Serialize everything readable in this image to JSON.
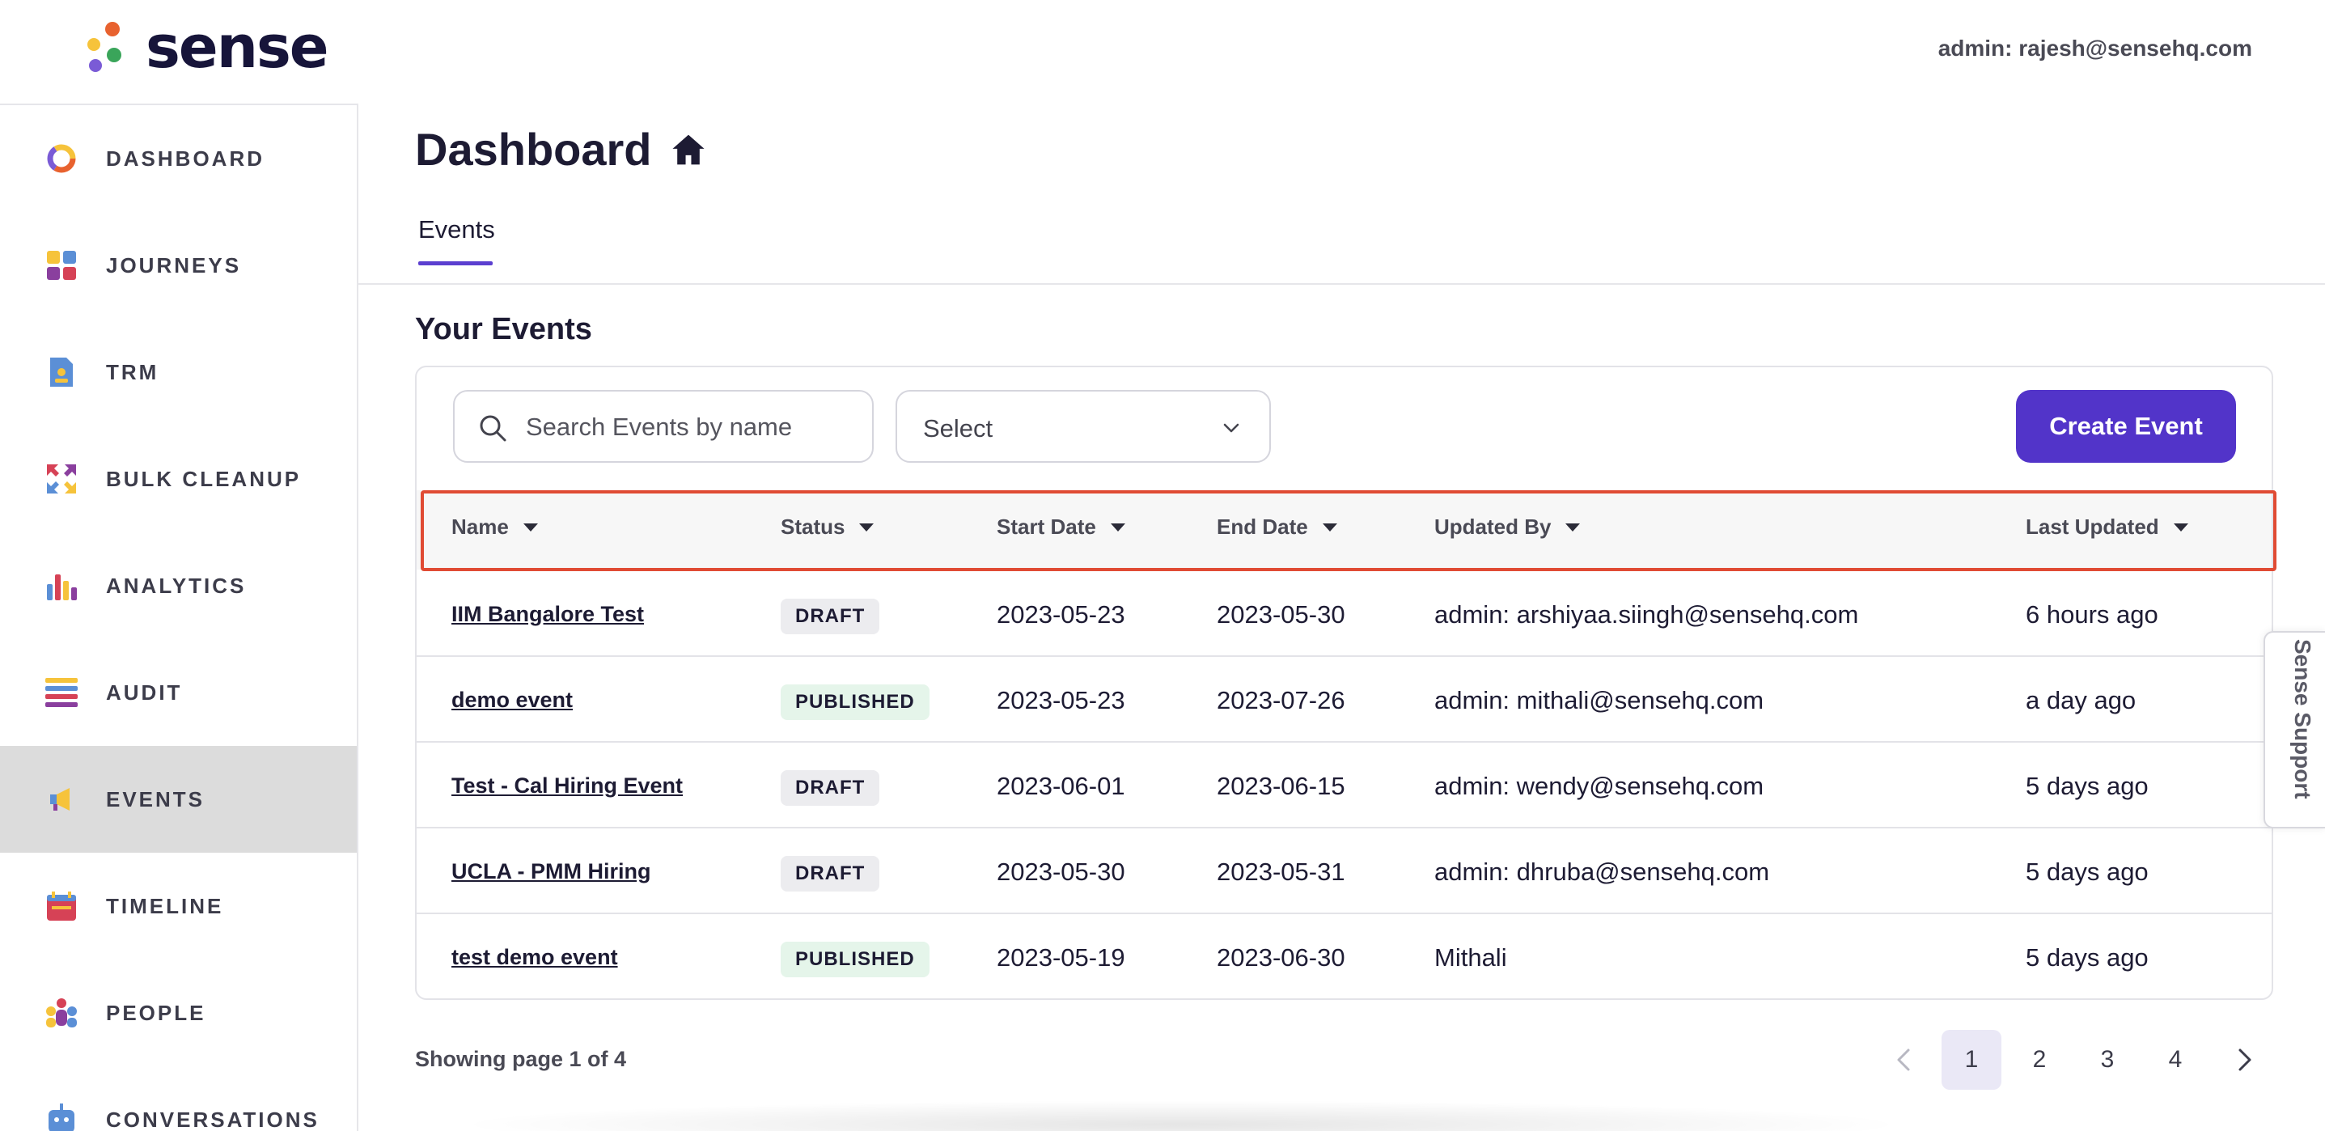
{
  "brand": {
    "name": "sense",
    "colors": {
      "accent": "#5234c9",
      "highlight_outline": "#e04b34",
      "dot_orange": "#e8622f",
      "dot_yellow": "#f6c33b",
      "dot_green": "#3aa55a",
      "dot_purple": "#7a5bd6"
    }
  },
  "header": {
    "admin_label": "admin: rajesh@sensehq.com"
  },
  "sidebar": {
    "items": [
      {
        "label": "DASHBOARD",
        "icon": "donut-chart-icon",
        "active": false
      },
      {
        "label": "JOURNEYS",
        "icon": "grid-squares-icon",
        "active": false
      },
      {
        "label": "TRM",
        "icon": "document-person-icon",
        "active": false
      },
      {
        "label": "BULK CLEANUP",
        "icon": "arrows-cleanup-icon",
        "active": false
      },
      {
        "label": "ANALYTICS",
        "icon": "bar-chart-icon",
        "active": false
      },
      {
        "label": "AUDIT",
        "icon": "list-lines-icon",
        "active": false
      },
      {
        "label": "EVENTS",
        "icon": "megaphone-icon",
        "active": true
      },
      {
        "label": "TIMELINE",
        "icon": "calendar-icon",
        "active": false
      },
      {
        "label": "PEOPLE",
        "icon": "people-group-icon",
        "active": false
      },
      {
        "label": "CONVERSATIONS",
        "icon": "chat-robot-icon",
        "active": false
      }
    ]
  },
  "main": {
    "title": "Dashboard",
    "title_icon": "home-icon",
    "tabs": [
      {
        "label": "Events",
        "active": true
      }
    ],
    "section_title": "Your Events",
    "search": {
      "placeholder": "Search Events by name",
      "value": ""
    },
    "select": {
      "value": "Select"
    },
    "create_button": "Create Event",
    "table": {
      "columns": [
        "Name",
        "Status",
        "Start Date",
        "End Date",
        "Updated By",
        "Last Updated"
      ],
      "rows": [
        {
          "name": "IIM Bangalore Test",
          "status": "DRAFT",
          "start": "2023-05-23",
          "end": "2023-05-30",
          "updated_by": "admin: arshiyaa.siingh@sensehq.com",
          "last_updated": "6 hours ago"
        },
        {
          "name": "demo event",
          "status": "PUBLISHED",
          "start": "2023-05-23",
          "end": "2023-07-26",
          "updated_by": "admin: mithali@sensehq.com",
          "last_updated": "a day ago"
        },
        {
          "name": "Test - Cal Hiring Event",
          "status": "DRAFT",
          "start": "2023-06-01",
          "end": "2023-06-15",
          "updated_by": "admin: wendy@sensehq.com",
          "last_updated": "5 days ago"
        },
        {
          "name": "UCLA - PMM Hiring",
          "status": "DRAFT",
          "start": "2023-05-30",
          "end": "2023-05-31",
          "updated_by": "admin: dhruba@sensehq.com",
          "last_updated": "5 days ago"
        },
        {
          "name": "test demo event",
          "status": "PUBLISHED",
          "start": "2023-05-19",
          "end": "2023-06-30",
          "updated_by": "Mithali",
          "last_updated": "5 days ago"
        }
      ]
    },
    "pagination": {
      "text": "Showing page 1 of 4",
      "pages": [
        "1",
        "2",
        "3",
        "4"
      ],
      "current": "1"
    }
  },
  "support_tab": "Sense Support"
}
